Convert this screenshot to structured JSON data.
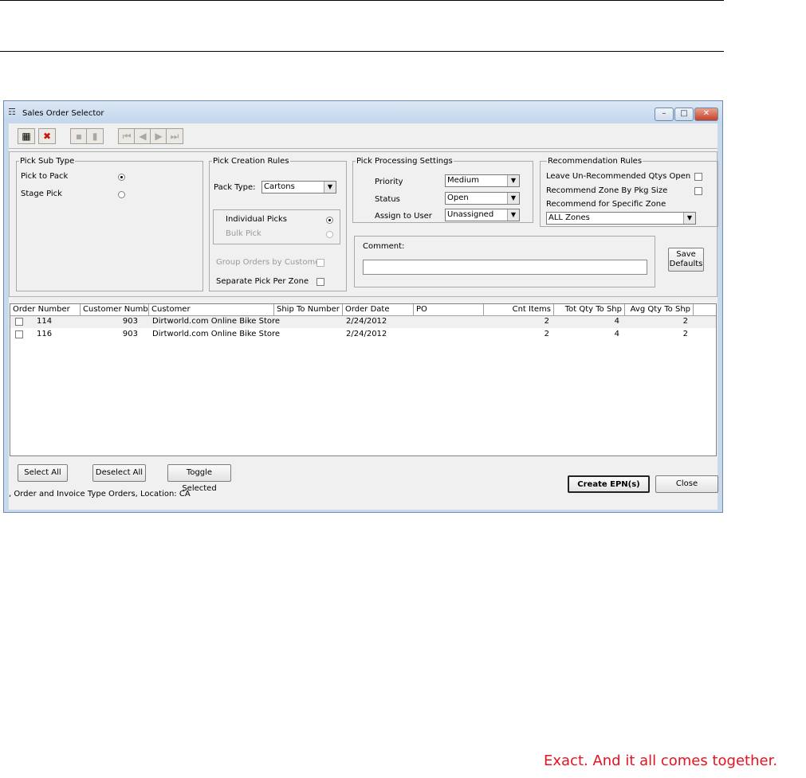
{
  "window": {
    "title": "Sales Order Selector",
    "caption_buttons": {
      "minimize": "–",
      "maximize": "□",
      "close": "✕"
    }
  },
  "toolbar": {
    "buttons": [
      {
        "icon": "calendar-icon",
        "glyph": "▦",
        "enabled": true
      },
      {
        "icon": "delete-x-icon",
        "glyph": "✖",
        "enabled": true
      },
      {
        "icon": "save-disk-icon",
        "glyph": "▪",
        "enabled": false
      },
      {
        "icon": "trash-icon",
        "glyph": "▮",
        "enabled": false
      },
      {
        "icon": "first-record-icon",
        "glyph": "⏮",
        "enabled": false
      },
      {
        "icon": "previous-record-icon",
        "glyph": "◀",
        "enabled": false
      },
      {
        "icon": "next-record-icon",
        "glyph": "▶",
        "enabled": false
      },
      {
        "icon": "last-record-icon",
        "glyph": "⏭",
        "enabled": false
      }
    ]
  },
  "pick_sub_type": {
    "legend": "Pick Sub Type",
    "options": [
      {
        "label": "Pick to Pack",
        "selected": true
      },
      {
        "label": "Stage Pick",
        "selected": false
      }
    ]
  },
  "pick_creation_rules": {
    "legend": "Pick Creation Rules",
    "pack_type_label": "Pack Type:",
    "pack_type_value": "Cartons",
    "pick_modes": [
      {
        "label": "Individual Picks",
        "selected": true,
        "enabled": true
      },
      {
        "label": "Bulk Pick",
        "selected": false,
        "enabled": false
      }
    ],
    "group_orders_label": "Group Orders by Customer",
    "group_orders_checked": false,
    "separate_pick_label": "Separate Pick Per Zone",
    "separate_pick_checked": false
  },
  "pick_processing_settings": {
    "legend": "Pick Processing Settings",
    "priority_label": "Priority",
    "priority_value": "Medium",
    "status_label": "Status",
    "status_value": "Open",
    "assign_label": "Assign to User",
    "assign_value": "Unassigned"
  },
  "recommendation_rules": {
    "legend": "Recommendation Rules",
    "leave_open_label": "Leave Un-Recommended Qtys Open",
    "leave_open_checked": false,
    "zone_by_pkg_label": "Recommend Zone By Pkg Size",
    "zone_by_pkg_checked": false,
    "specific_zone_label": "Recommend for Specific Zone",
    "specific_zone_value": "ALL Zones"
  },
  "comment": {
    "label": "Comment:",
    "value": ""
  },
  "save_defaults_button": {
    "line1": "Save",
    "line2": "Defaults"
  },
  "grid": {
    "columns": [
      "Order Number",
      "Customer Number",
      "Customer",
      "Ship To Number",
      "Order Date",
      "PO",
      "Cnt Items",
      "Tot Qty To Shp",
      "Avg Qty To Shp"
    ],
    "rows": [
      {
        "checked": false,
        "order_number": "114",
        "customer_number": "903",
        "customer": "Dirtworld.com Online Bike Store",
        "ship_to": "",
        "order_date": "2/24/2012",
        "po": "",
        "cnt_items": "2",
        "tot_qty": "4",
        "avg_qty": "2"
      },
      {
        "checked": false,
        "order_number": "116",
        "customer_number": "903",
        "customer": "Dirtworld.com Online Bike Store",
        "ship_to": "",
        "order_date": "2/24/2012",
        "po": "",
        "cnt_items": "2",
        "tot_qty": "4",
        "avg_qty": "2"
      }
    ]
  },
  "buttons": {
    "select_all": "Select All",
    "deselect_all": "Deselect All",
    "toggle_selected": "Toggle Selected",
    "create_epn": "Create EPN(s)",
    "close": "Close"
  },
  "status_text": ", Order and Invoice Type Orders, Location: CA",
  "tagline": "Exact. And it all comes together.",
  "colors": {
    "tagline": "#e8111f",
    "window_frame": "#c9d9ec"
  }
}
